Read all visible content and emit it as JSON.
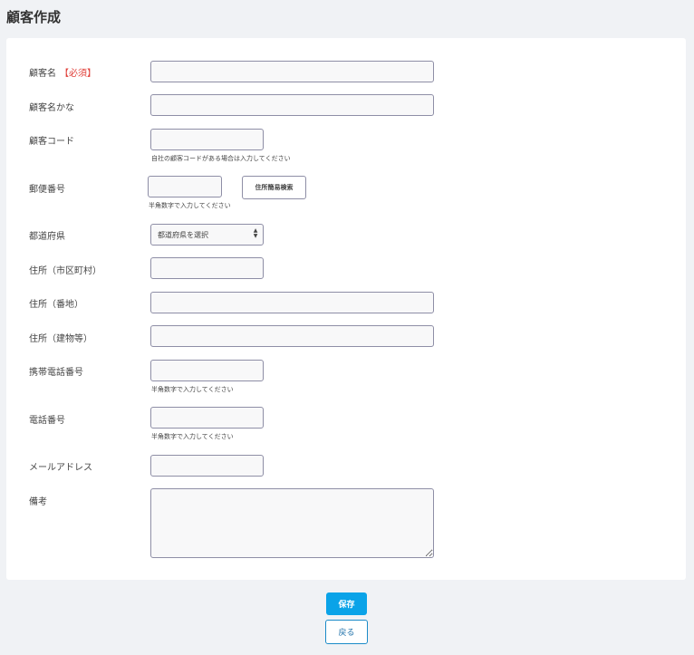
{
  "page": {
    "title": "顧客作成"
  },
  "form": {
    "customer_name": {
      "label": "顧客名",
      "required_mark": "【必須】",
      "value": ""
    },
    "customer_name_kana": {
      "label": "顧客名かな",
      "value": ""
    },
    "customer_code": {
      "label": "顧客コード",
      "value": "",
      "hint": "自社の顧客コードがある場合は入力してください"
    },
    "postal_code": {
      "label": "郵便番号",
      "value": "",
      "hint": "半角数字で入力してください",
      "search_button": "住所簡易検索"
    },
    "prefecture": {
      "label": "都道府県",
      "selected": "都道府県を選択"
    },
    "address_city": {
      "label": "住所（市区町村）",
      "value": ""
    },
    "address_number": {
      "label": "住所（番地）",
      "value": ""
    },
    "address_building": {
      "label": "住所（建物等）",
      "value": ""
    },
    "mobile_phone": {
      "label": "携帯電話番号",
      "value": "",
      "hint": "半角数字で入力してください"
    },
    "phone": {
      "label": "電話番号",
      "value": "",
      "hint": "半角数字で入力してください"
    },
    "email": {
      "label": "メールアドレス",
      "value": ""
    },
    "notes": {
      "label": "備考",
      "value": ""
    }
  },
  "actions": {
    "save": "保存",
    "back": "戻る"
  },
  "colors": {
    "primary": "#0aa3e8",
    "required": "#e0403a",
    "background": "#f0f2f5"
  },
  "icons": {
    "select_arrows": "updown-chevron-icon",
    "resize": "resize-grip-icon"
  }
}
